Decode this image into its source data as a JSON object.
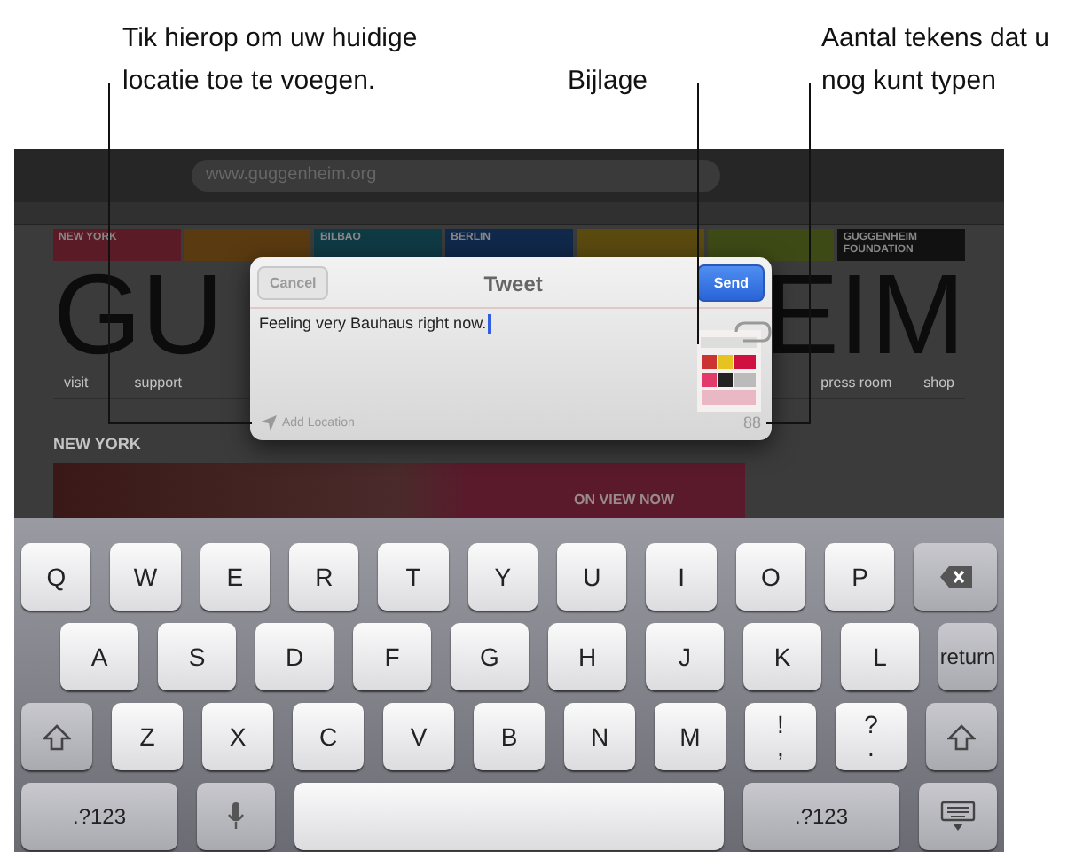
{
  "callouts": [
    {
      "text": "Tik hierop om uw huidige\nlocatie toe te voegen."
    },
    {
      "text": "Bijlage"
    },
    {
      "text": "Aantal tekens dat u\nnog kunt typen"
    }
  ],
  "browser": {
    "url": "www.guggenheim.org"
  },
  "webpage": {
    "cities": [
      {
        "label": "NEW YORK",
        "color": "#5a1a26"
      },
      {
        "color": "#5a3a10"
      },
      {
        "label": "BILBAO",
        "color": "#0f3a44"
      },
      {
        "label": "BERLIN",
        "color": "#10284a"
      },
      {
        "color": "#5a4a10"
      },
      {
        "color": "#3e4a16"
      },
      {
        "label": "GUGGENHEIM\nFOUNDATION",
        "color": "#111111"
      }
    ],
    "logo_left": "GU",
    "logo_right": "EIM",
    "nav": [
      "visit",
      "support",
      "press room",
      "shop"
    ],
    "section": "NEW YORK",
    "banner": "ON VIEW NOW"
  },
  "tweet": {
    "cancel": "Cancel",
    "title": "Tweet",
    "send": "Send",
    "text": "Feeling very Bauhaus right now.",
    "location": "Add Location",
    "count": "88"
  },
  "keyboard": {
    "rows": [
      {
        "keys": [
          {
            "kind": "char",
            "label": "Q"
          },
          {
            "kind": "char",
            "label": "W"
          },
          {
            "kind": "char",
            "label": "E"
          },
          {
            "kind": "char",
            "label": "R"
          },
          {
            "kind": "char",
            "label": "T"
          },
          {
            "kind": "char",
            "label": "Y"
          },
          {
            "kind": "char",
            "label": "U"
          },
          {
            "kind": "char",
            "label": "I"
          },
          {
            "kind": "char",
            "label": "O"
          },
          {
            "kind": "char",
            "label": "P"
          },
          {
            "kind": "backspace"
          }
        ]
      },
      {
        "keys": [
          {
            "kind": "char",
            "label": "A"
          },
          {
            "kind": "char",
            "label": "S"
          },
          {
            "kind": "char",
            "label": "D"
          },
          {
            "kind": "char",
            "label": "F"
          },
          {
            "kind": "char",
            "label": "G"
          },
          {
            "kind": "char",
            "label": "H"
          },
          {
            "kind": "char",
            "label": "J"
          },
          {
            "kind": "char",
            "label": "K"
          },
          {
            "kind": "char",
            "label": "L"
          },
          {
            "kind": "wide",
            "label": "return"
          }
        ]
      },
      {
        "keys": [
          {
            "kind": "shift"
          },
          {
            "kind": "char",
            "label": "Z"
          },
          {
            "kind": "char",
            "label": "X"
          },
          {
            "kind": "char",
            "label": "C"
          },
          {
            "kind": "char",
            "label": "V"
          },
          {
            "kind": "char",
            "label": "B"
          },
          {
            "kind": "char",
            "label": "N"
          },
          {
            "kind": "char",
            "label": "M"
          },
          {
            "kind": "char",
            "label": "!\n,"
          },
          {
            "kind": "char",
            "label": "?\n."
          },
          {
            "kind": "shift"
          }
        ]
      },
      {
        "keys": [
          {
            "kind": "wide",
            "label": ".?123"
          },
          {
            "kind": "mic"
          },
          {
            "kind": "space"
          },
          {
            "kind": "wide",
            "label": ".?123"
          },
          {
            "kind": "hide"
          }
        ]
      }
    ]
  }
}
